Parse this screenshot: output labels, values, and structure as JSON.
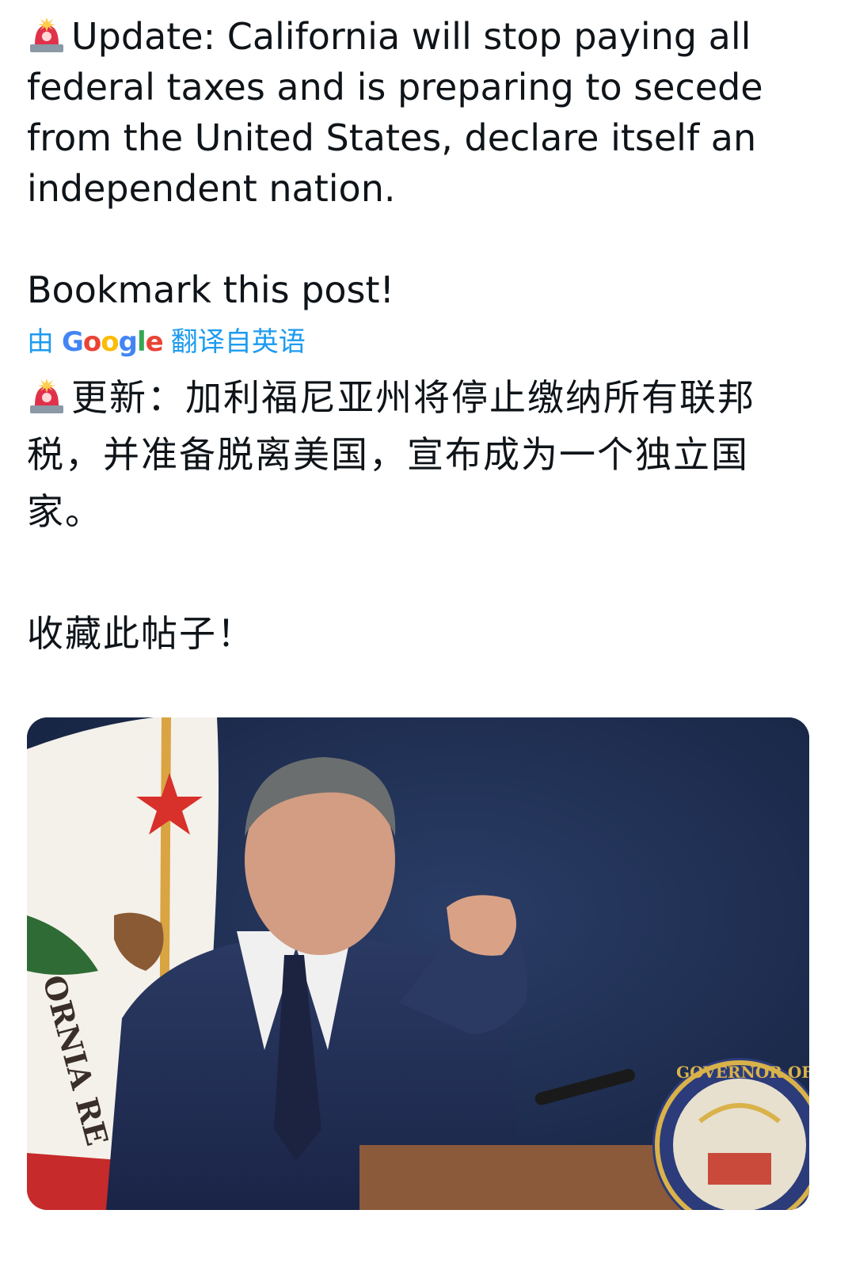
{
  "post": {
    "en_lines": [
      "Update: California will stop paying all",
      "federal taxes and is preparing to secede",
      "from the United States, declare itself an",
      "independent nation."
    ],
    "en_cta": "Bookmark this post!",
    "translate": {
      "prefix": "由",
      "brand": "Google",
      "suffix": "翻译自英语"
    },
    "zh_lines": [
      "更新：加利福尼亚州将停止缴纳所有联邦",
      "税，并准备脱离美国，宣布成为一个独立国",
      "家。"
    ],
    "zh_cta": "收藏此帖子！",
    "siren_emoji": "rotating-light-icon"
  },
  "media": {
    "flag_text": "ORNIA RE",
    "seal_text": "GOVERNOR OF THE STATE OF"
  },
  "colors": {
    "translate_link": "#1d9bf0",
    "text": "#0f1419",
    "photo_background": "#1b2a4a"
  }
}
